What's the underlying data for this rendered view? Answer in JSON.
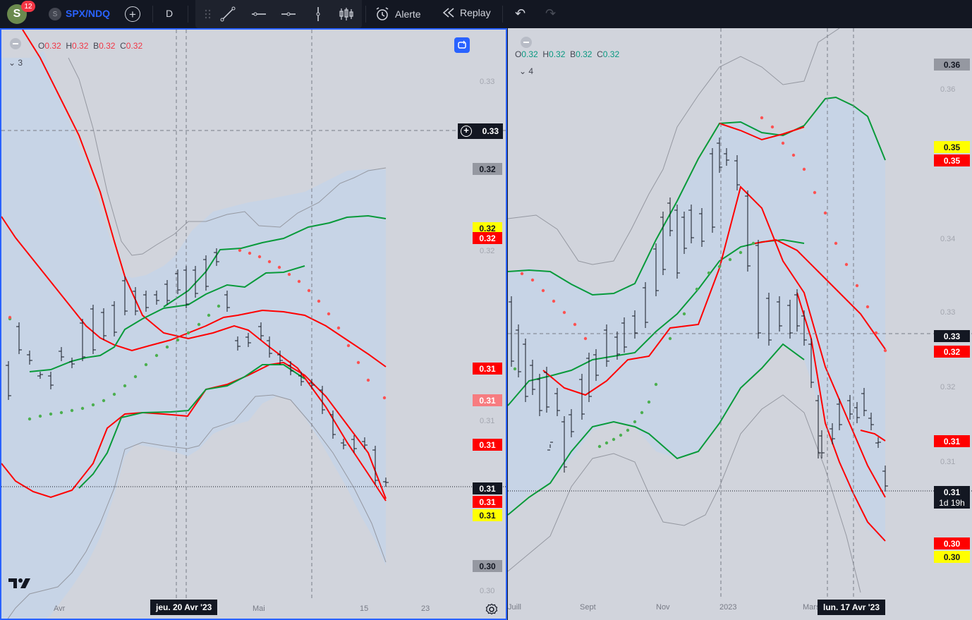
{
  "toolbar": {
    "avatar_letter": "S",
    "notification_count": "12",
    "symbol_icon_letter": "S",
    "symbol": "SPX/NDQ",
    "interval": "D",
    "alert_label": "Alerte",
    "replay_label": "Replay"
  },
  "left_pane": {
    "legend": {
      "o_label": "O",
      "o": "0.32",
      "h_label": "H",
      "h": "0.32",
      "b_label": "B",
      "b": "0.32",
      "c_label": "C",
      "c": "0.32"
    },
    "indicator_count": "3",
    "crosshair_price": "0.33",
    "price_tags": [
      {
        "text": "0.32",
        "bg": "#9598a1",
        "color": "#131722"
      },
      {
        "text": "0.32",
        "bg": "#ffff00",
        "color": "#131722"
      },
      {
        "text": "0.32",
        "bg": "#ff0000",
        "color": "#ffffff"
      },
      {
        "text": "0.31",
        "bg": "#ff0000",
        "color": "#ffffff"
      },
      {
        "text": "0.31",
        "bg": "#f77c80",
        "color": "#ffffff"
      },
      {
        "text": "0.31",
        "bg": "#ff0000",
        "color": "#ffffff"
      },
      {
        "text": "0.31",
        "bg": "#131722",
        "color": "#ffffff"
      },
      {
        "text": "0.31",
        "bg": "#ff0000",
        "color": "#ffffff"
      },
      {
        "text": "0.31",
        "bg": "#ffff00",
        "color": "#131722"
      },
      {
        "text": "0.30",
        "bg": "#9598a1",
        "color": "#131722"
      }
    ],
    "scale_labels": [
      "0.33",
      "0.32",
      "0.31",
      "0.30"
    ],
    "time_labels": [
      "Avr",
      "Mai",
      "15",
      "23"
    ],
    "crosshair_time": "jeu. 20 Avr '23"
  },
  "right_pane": {
    "legend": {
      "o_label": "O",
      "o": "0.32",
      "h_label": "H",
      "h": "0.32",
      "b_label": "B",
      "b": "0.32",
      "c_label": "C",
      "c": "0.32"
    },
    "indicator_count": "4",
    "price_tags": [
      {
        "text": "0.36",
        "bg": "#9598a1",
        "color": "#131722"
      },
      {
        "text": "0.35",
        "bg": "#ffff00",
        "color": "#131722"
      },
      {
        "text": "0.35",
        "bg": "#ff0000",
        "color": "#ffffff"
      },
      {
        "text": "0.33",
        "bg": "#131722",
        "color": "#ffffff"
      },
      {
        "text": "0.32",
        "bg": "#ff0000",
        "color": "#ffffff"
      },
      {
        "text": "0.31",
        "bg": "#ff0000",
        "color": "#ffffff"
      },
      {
        "text": "0.31",
        "bg": "#131722",
        "color": "#ffffff"
      },
      {
        "text": "0.30",
        "bg": "#ff0000",
        "color": "#ffffff"
      },
      {
        "text": "0.30",
        "bg": "#ffff00",
        "color": "#131722"
      }
    ],
    "countdown": "1d 19h",
    "scale_labels": [
      "0.36",
      "0.34",
      "0.33",
      "0.32",
      "0.31"
    ],
    "time_labels": [
      "Juill",
      "Sept",
      "Nov",
      "2023",
      "Mars"
    ],
    "crosshair_time": "lun. 17 Avr '23"
  },
  "colors": {
    "accent": "#2962ff",
    "upper_band": "#ff0000",
    "lower_band": "#089a3a",
    "channel_fill": "#c5d3e8",
    "pane_bg": "#d1d4dc"
  }
}
